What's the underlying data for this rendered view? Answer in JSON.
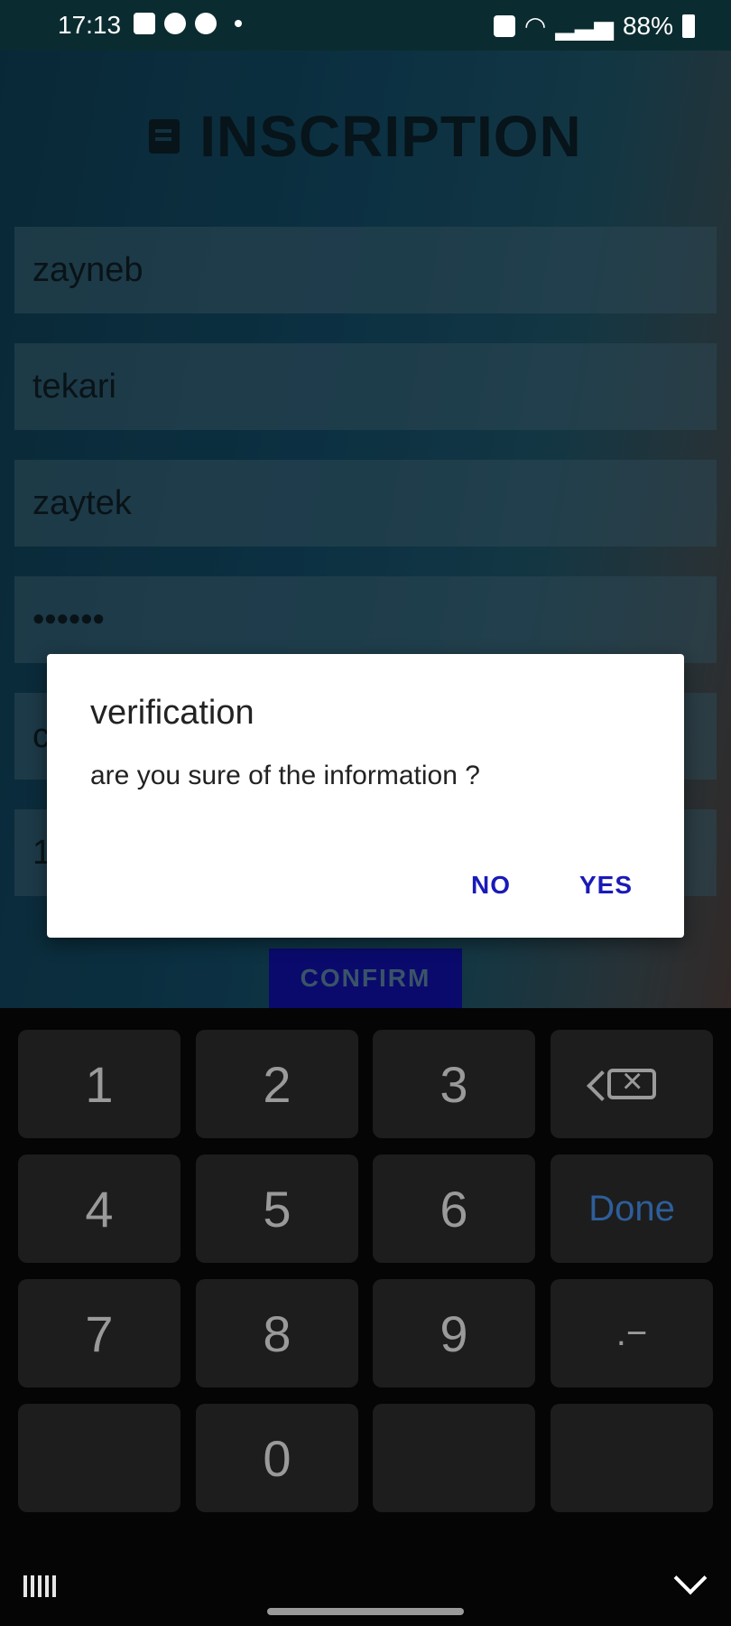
{
  "status_bar": {
    "time": "17:13",
    "battery": "88%"
  },
  "title": "INSCRIPTION",
  "fields": [
    {
      "value": "zayneb"
    },
    {
      "value": "tekari"
    },
    {
      "value": "zaytek"
    },
    {
      "value": "••••••"
    },
    {
      "value": "c"
    },
    {
      "value": "1"
    }
  ],
  "confirm_label": "CONFIRM",
  "dialog": {
    "title": "verification",
    "message": "are you sure of the information ?",
    "no_label": "NO",
    "yes_label": "YES"
  },
  "keyboard": {
    "keys": [
      "1",
      "2",
      "3",
      "4",
      "5",
      "6",
      "7",
      "8",
      "9",
      "0"
    ],
    "done_label": "Done",
    "symbol_key": ".−"
  }
}
